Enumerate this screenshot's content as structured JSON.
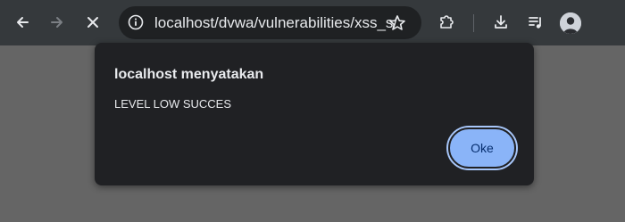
{
  "browser": {
    "url": "localhost/dvwa/vulnerabilities/xss_s/",
    "icons": {
      "back": "arrow-left-icon",
      "forward": "arrow-right-icon",
      "stop": "close-icon",
      "site_info": "info-icon",
      "bookmark": "star-icon",
      "extensions": "puzzle-icon",
      "downloads": "download-icon",
      "media": "playlist-music-icon",
      "profile": "avatar"
    }
  },
  "dialog": {
    "title": "localhost menyatakan",
    "message": "LEVEL LOW SUCCES",
    "ok_label": "Oke"
  },
  "colors": {
    "toolbar_bg": "#35393c",
    "omnibox_bg": "#1f2123",
    "page_bg": "#656565",
    "dialog_bg": "#202124",
    "accent": "#8ab4f8"
  }
}
